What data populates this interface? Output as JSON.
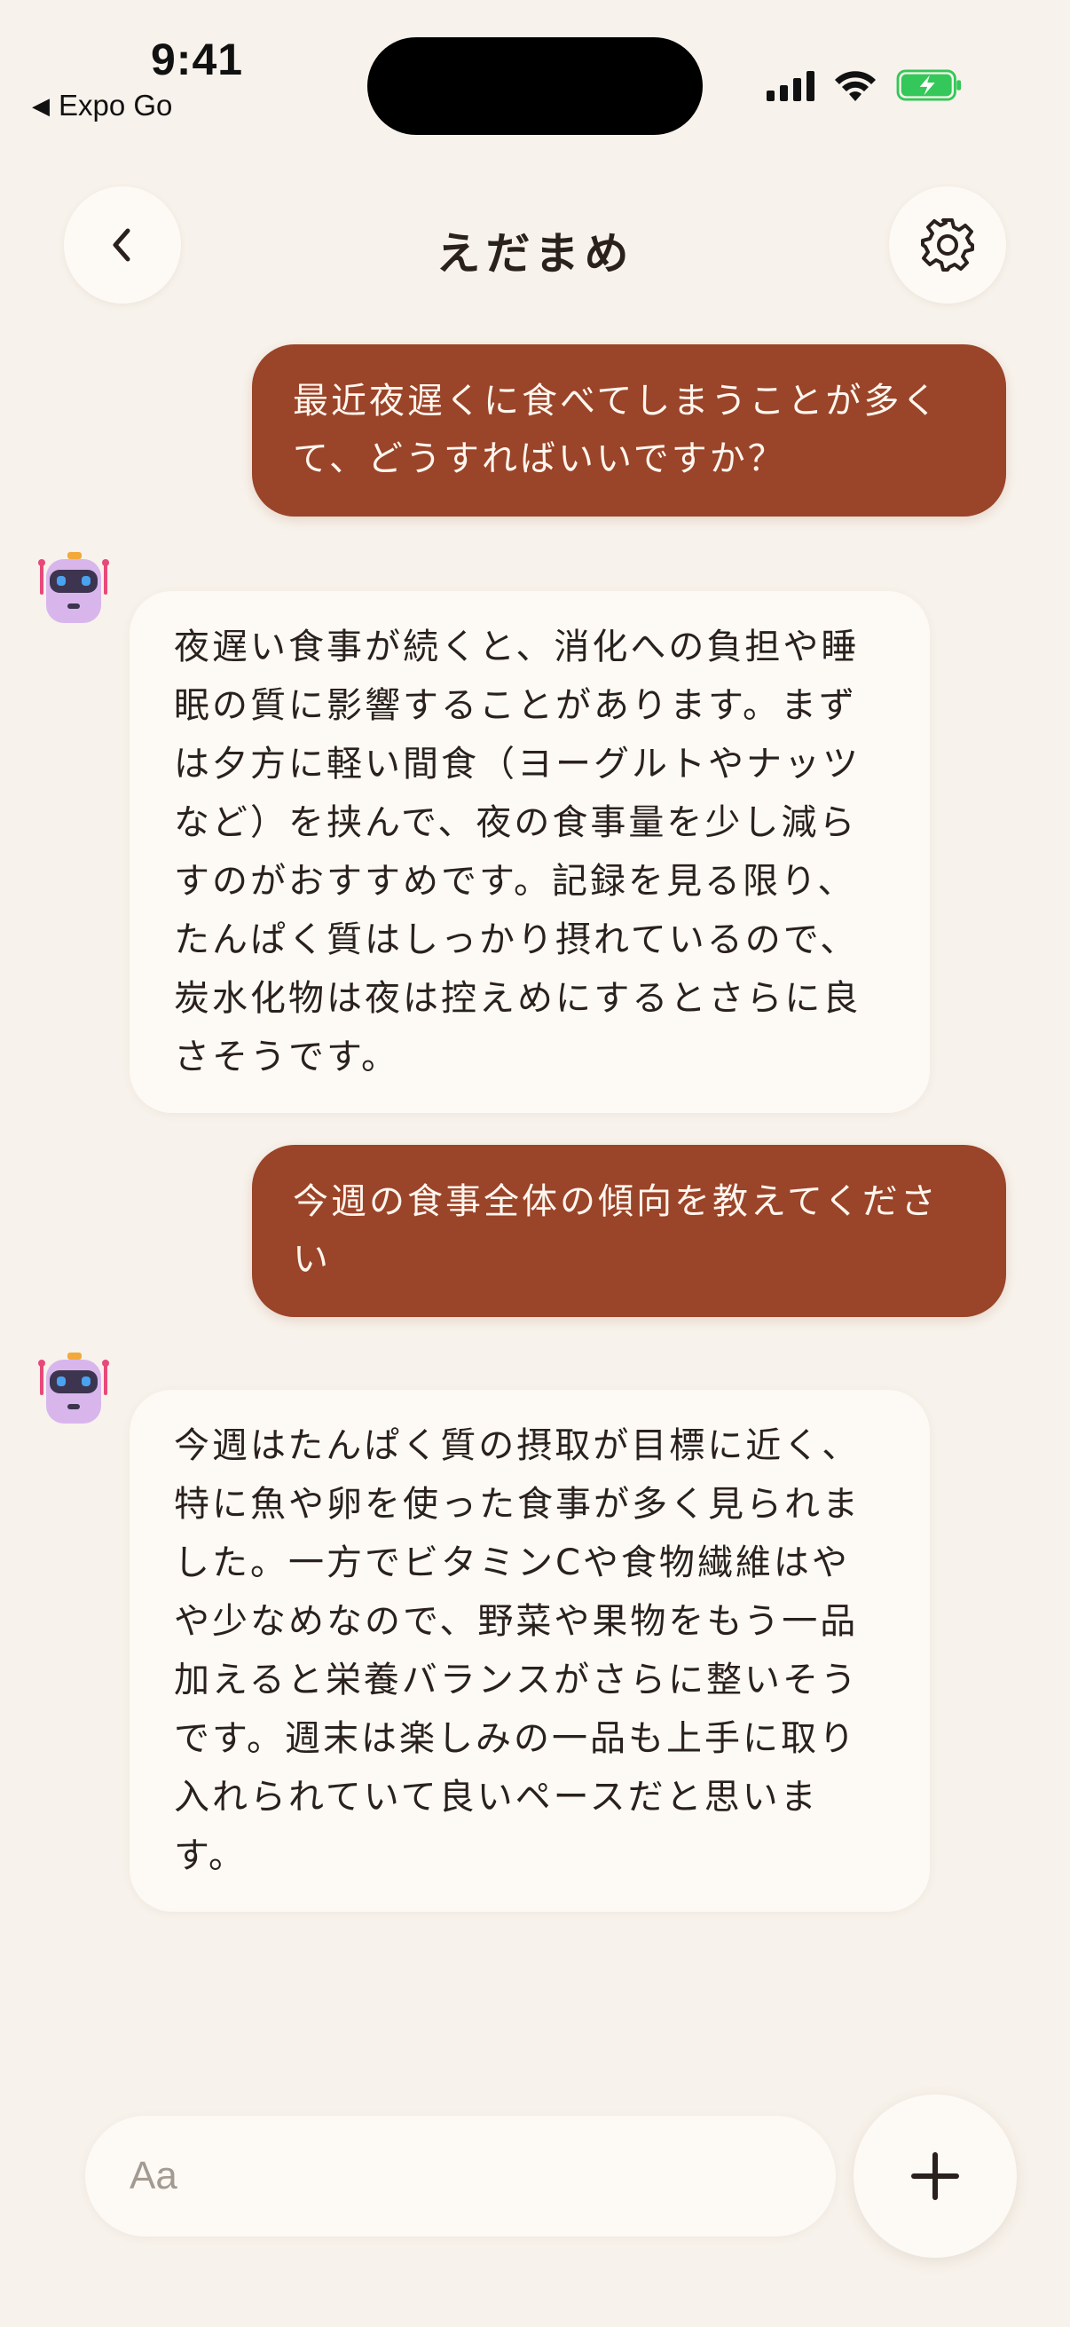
{
  "status_bar": {
    "time": "9:41",
    "back_label": "Expo Go",
    "back_glyph": "◀"
  },
  "header": {
    "title": "えだまめ",
    "back_icon": "chevron-left-icon",
    "settings_icon": "gear-icon"
  },
  "messages": [
    {
      "role": "user",
      "text": "最近夜遅くに食べてしまうことが多くて、どうすればいいですか？"
    },
    {
      "role": "assistant",
      "text": "夜遅い食事が続くと、消化への負担や睡眠の質に影響することがあります。まずは夕方に軽い間食（ヨーグルトやナッツなど）を挟んで、夜の食事量を少し減らすのがおすすめです。記録を見る限り、たんぱく質はしっかり摂れているので、炭水化物は夜は控えめにするとさらに良さそうです。"
    },
    {
      "role": "user",
      "text": "今週の食事全体の傾向を教えてください"
    },
    {
      "role": "assistant",
      "text": "今週はたんぱく質の摂取が目標に近く、特に魚や卵を使った食事が多く見られました。一方でビタミンCや食物繊維はやや少なめなので、野菜や果物をもう一品加えると栄養バランスがさらに整いそうです。週末は楽しみの一品も上手に取り入れられていて良いペースだと思います。"
    }
  ],
  "composer": {
    "placeholder": "Aa",
    "add_icon": "plus-icon"
  },
  "colors": {
    "background": "#f7f2eb",
    "user_bubble": "#9a4429",
    "assistant_bubble": "#fdfaf5",
    "battery_green": "#34c759"
  }
}
